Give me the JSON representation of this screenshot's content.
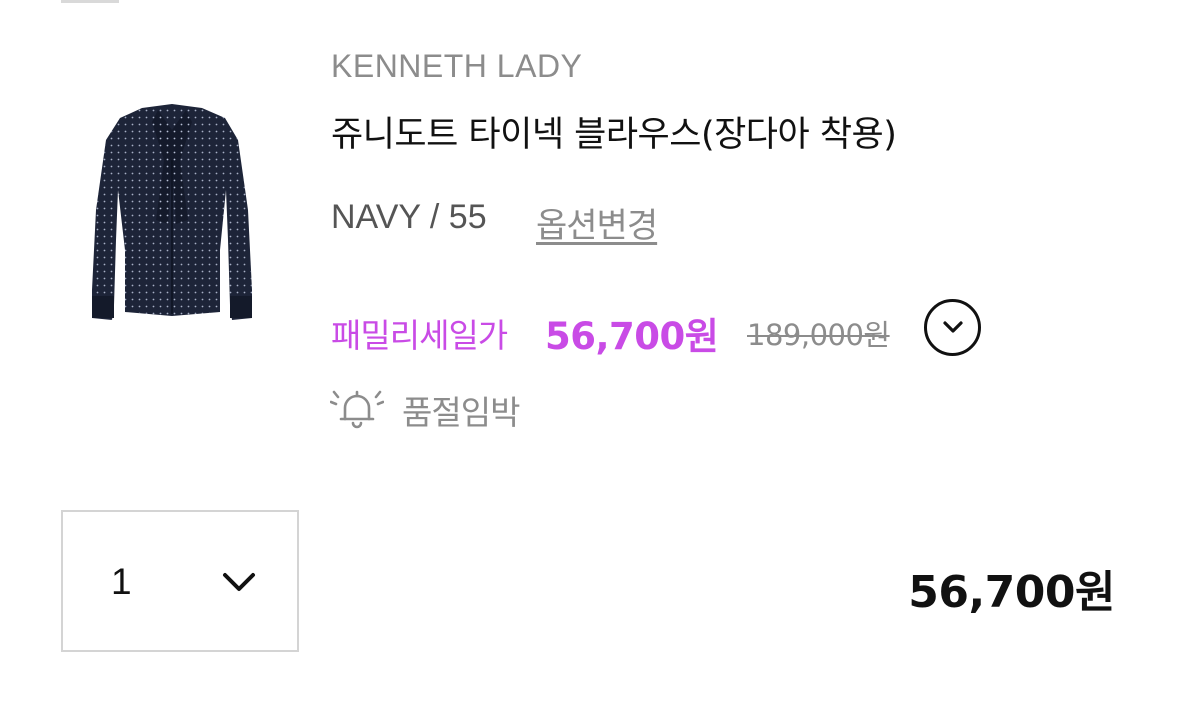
{
  "product": {
    "brand": "KENNETH LADY",
    "name": "쥬니도트 타이넥 블라우스(장다아 착용)",
    "option": "NAVY / 55",
    "option_change_label": "옵션변경",
    "sale_label": "패밀리세일가",
    "sale_price": "56,700원",
    "original_price": "189,000원",
    "stock_status": "품절임박",
    "image_icon": "navy-polka-dot-blouse-image"
  },
  "quantity": {
    "value": "1",
    "icon": "chevron-down-icon"
  },
  "total": {
    "price": "56,700원"
  },
  "colors": {
    "sale": "#c94be6",
    "muted": "#8c8c8c",
    "text": "#111111",
    "border": "#d4d4d4"
  }
}
